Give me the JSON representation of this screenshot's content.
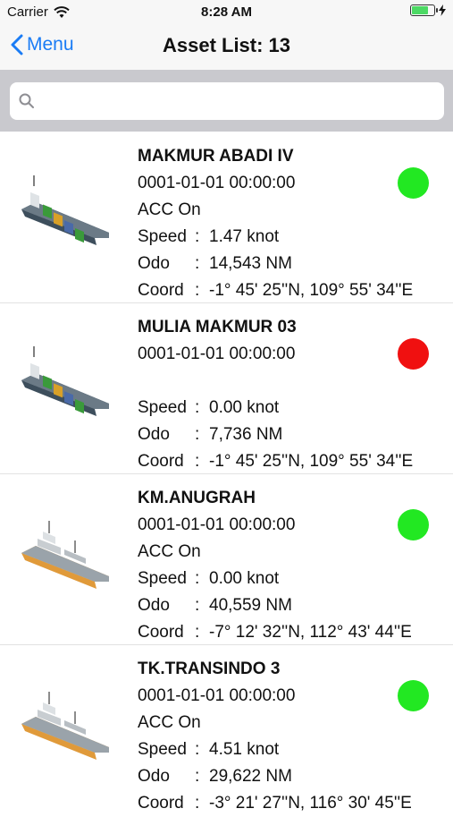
{
  "status_bar": {
    "carrier": "Carrier",
    "time": "8:28 AM"
  },
  "nav": {
    "back_label": "Menu",
    "title": "Asset List: 13"
  },
  "search": {
    "placeholder": "",
    "value": ""
  },
  "assets": [
    {
      "name": "MAKMUR ABADI IV",
      "datetime": "0001-01-01 00:00:00",
      "acc": "ACC On",
      "speed_label": "Speed",
      "speed": "1.47 knot",
      "odo_label": "Odo",
      "odo": "14,543 NM",
      "coord_label": "Coord",
      "coord": "-1° 45' 25''N, 109° 55' 34''E",
      "status_color": "#22e822",
      "ship_icon": "container-ship-icon"
    },
    {
      "name": "MULIA MAKMUR 03",
      "datetime": "0001-01-01 00:00:00",
      "acc": "",
      "speed_label": "Speed",
      "speed": "0.00 knot",
      "odo_label": "Odo",
      "odo": "7,736 NM",
      "coord_label": "Coord",
      "coord": "-1° 45' 25''N, 109° 55' 34''E",
      "status_color": "#f01010",
      "ship_icon": "container-ship-icon"
    },
    {
      "name": "KM.ANUGRAH",
      "datetime": "0001-01-01 00:00:00",
      "acc": "ACC On",
      "speed_label": "Speed",
      "speed": "0.00 knot",
      "odo_label": "Odo",
      "odo": "40,559 NM",
      "coord_label": "Coord",
      "coord": "-7° 12' 32''N, 112° 43' 44''E",
      "status_color": "#22e822",
      "ship_icon": "cargo-ship-icon"
    },
    {
      "name": "TK.TRANSINDO 3",
      "datetime": "0001-01-01 00:00:00",
      "acc": "ACC On",
      "speed_label": "Speed",
      "speed": "4.51 knot",
      "odo_label": "Odo",
      "odo": "29,622 NM",
      "coord_label": "Coord",
      "coord": "-3° 21' 27''N, 116° 30' 45''E",
      "status_color": "#22e822",
      "ship_icon": "cargo-ship-icon"
    }
  ]
}
